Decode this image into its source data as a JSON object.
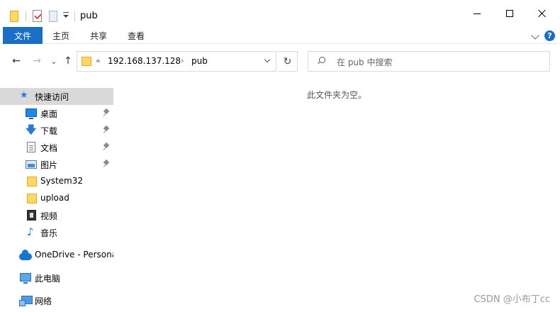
{
  "window": {
    "title": "pub",
    "controls": {
      "minimize": "minimize",
      "maximize": "maximize",
      "close": "close"
    }
  },
  "ribbon": {
    "file_tab": "文件",
    "tabs": [
      "主页",
      "共享",
      "查看"
    ],
    "help": "?"
  },
  "navigation": {
    "back": "←",
    "forward": "→",
    "recent": "⌄",
    "up": "↑",
    "address": {
      "overflow": "«",
      "segments": [
        "192.168.137.128",
        "pub"
      ],
      "separator": "›"
    },
    "refresh": "↻",
    "search_placeholder": "在 pub 中搜索"
  },
  "sidebar": {
    "items": [
      {
        "label": "快速访问",
        "icon": "star-icon",
        "selected": true
      },
      {
        "label": "桌面",
        "icon": "desktop-icon",
        "pinned": true
      },
      {
        "label": "下载",
        "icon": "download-icon",
        "pinned": true
      },
      {
        "label": "文档",
        "icon": "document-icon",
        "pinned": true
      },
      {
        "label": "图片",
        "icon": "picture-icon",
        "pinned": true
      },
      {
        "label": "System32",
        "icon": "folder-icon"
      },
      {
        "label": "upload",
        "icon": "folder-icon"
      },
      {
        "label": "视频",
        "icon": "video-icon"
      },
      {
        "label": "音乐",
        "icon": "music-icon"
      },
      {
        "label": "OneDrive - Persona",
        "icon": "onedrive-icon"
      },
      {
        "label": "此电脑",
        "icon": "computer-icon"
      },
      {
        "label": "网络",
        "icon": "network-icon"
      }
    ]
  },
  "content": {
    "empty_message": "此文件夹为空。"
  },
  "watermark": "CSDN @小布丁cc",
  "colors": {
    "accent": "#1a6fc4",
    "selected_bg": "#d9d9d9",
    "folder": "#ffd863"
  }
}
